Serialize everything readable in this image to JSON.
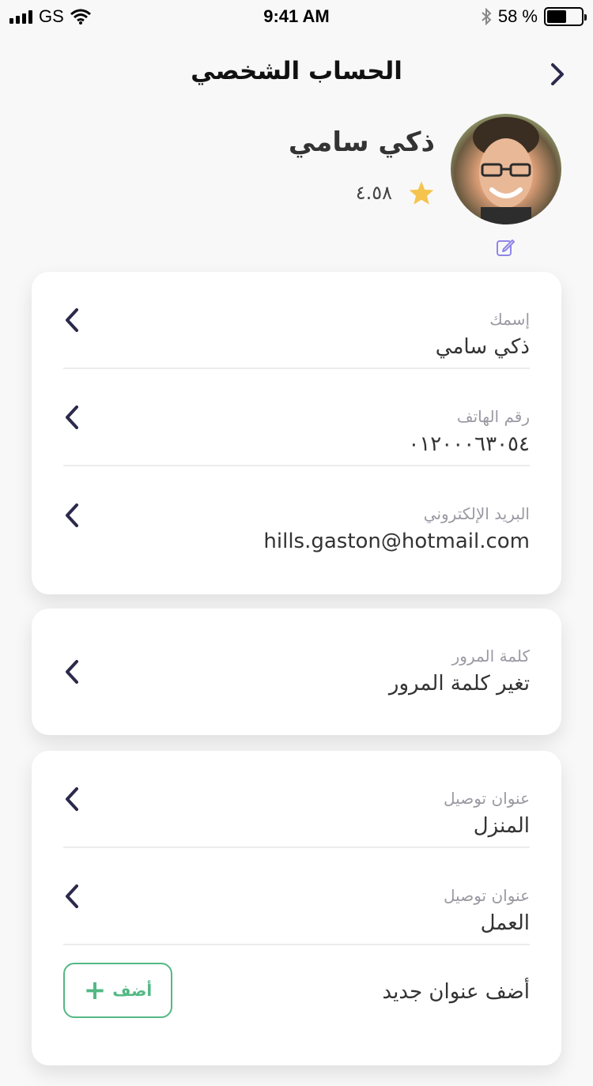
{
  "status_bar": {
    "carrier": "GS",
    "time": "9:41 AM",
    "battery_percent": "58 %",
    "battery_level": 0.58
  },
  "header": {
    "title": "الحساب الشخصي"
  },
  "profile": {
    "name": "ذكي سامي",
    "rating": "٤.٥٨",
    "star_color": "#f5c44e"
  },
  "personal_info": [
    {
      "label": "إسمك",
      "value": "ذكي سامي"
    },
    {
      "label": "رقم الهاتف",
      "value": "٠١٢٠٠٠٦٣٠٥٤"
    },
    {
      "label": "البريد الإلكتروني",
      "value": "hills.gaston@hotmail.com"
    }
  ],
  "password": {
    "label": "كلمة المرور",
    "value": "تغير كلمة المرور"
  },
  "addresses": [
    {
      "label": "عنوان توصيل",
      "value": "المنزل"
    },
    {
      "label": "عنوان توصيل",
      "value": "العمل"
    }
  ],
  "add_address": {
    "text": "أضف عنوان جديد",
    "button_label": "أضف",
    "accent": "#53b884"
  },
  "colors": {
    "chevron": "#2b2a4c",
    "edit_icon": "#8f86e8"
  }
}
